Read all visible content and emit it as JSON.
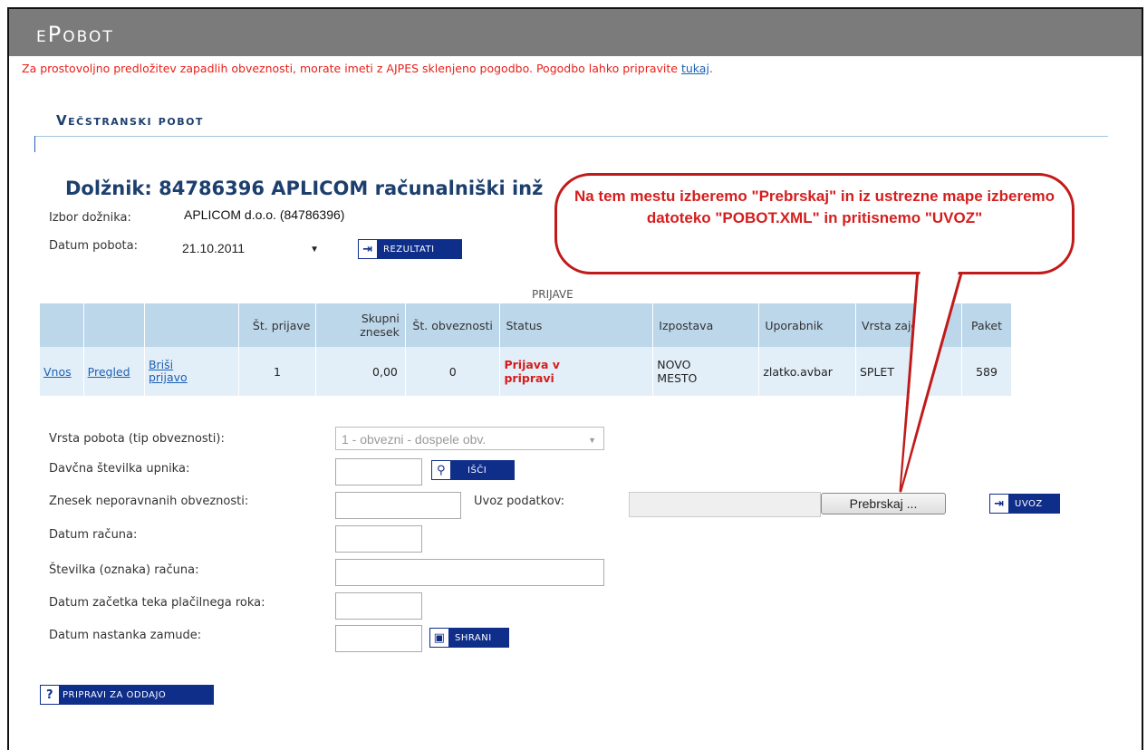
{
  "app": {
    "title": "ePobot"
  },
  "notice": {
    "text": "Za prostovoljno predložitev zapadlih obveznosti, morate imeti z AJPES sklenjeno pogodbo. Pogodbo lahko pripravite ",
    "link": "tukaj",
    "end": "."
  },
  "section": {
    "title": "Večstranski pobot"
  },
  "debtor": {
    "heading": "Dolžnik:  84786396  APLICOM računalniški inž"
  },
  "form_top": {
    "izbor_label": "Izbor dožnika:",
    "izbor_value": "APLICOM d.o.o. (84786396)",
    "datum_label": "Datum pobota:",
    "datum_value": "21.10.2011",
    "rezultati_label": "REZULTATI"
  },
  "table": {
    "caption": "PRIJAVE",
    "headers": [
      "",
      "",
      "",
      "Št. prijave",
      "Skupni znesek",
      "Št. obveznosti",
      "Status",
      "Izpostava",
      "Uporabnik",
      "Vrsta zajem",
      "Paket"
    ],
    "row": {
      "vnos": "Vnos",
      "pregled": "Pregled",
      "brisi": "Briši prijavo",
      "st_prijave": "1",
      "znesek": "0,00",
      "st_obveznosti": "0",
      "status": "Prijava v pripravi",
      "izpostava": "NOVO MESTO",
      "uporabnik": "zlatko.avbar",
      "vrsta": "SPLET",
      "paket": "589"
    }
  },
  "form": {
    "vrsta_label": "Vrsta pobota (tip obveznosti):",
    "vrsta_value": "1 - obvezni - dospele obv.",
    "davcna_label": "Davčna številka upnika:",
    "isci_label": "IŠČI",
    "znesek_label": "Znesek neporavnanih obveznosti:",
    "uvoz_label": "Uvoz podatkov:",
    "browse_label": "Prebrskaj ...",
    "uvoz_button": "UVOZ",
    "datum_racuna_label": "Datum računa:",
    "stevilka_label": "Številka (oznaka) računa:",
    "datum_zacetka_label": "Datum začetka teka plačilnega roka:",
    "datum_zamude_label": "Datum nastanka zamude:",
    "shrani_label": "SHRANI",
    "pripravi_label": "PRIPRAVI ZA ODDAJO"
  },
  "callout": {
    "text": "Na tem mestu izberemo \"Prebrskaj\" in iz ustrezne mape izberemo datoteko \"POBOT.XML\" in pritisnemo \"UVOZ\""
  },
  "colors": {
    "accent": "#0f2e8a",
    "title_bar": "#7b7b7b",
    "notice": "#e8201a",
    "callout": "#c11a1a"
  }
}
